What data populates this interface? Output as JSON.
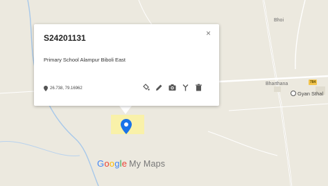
{
  "map": {
    "labels": {
      "bhoi": "Bhoi",
      "bharthana": "Bharthana",
      "poi": "Gyan Sthal"
    },
    "road_badge": "784"
  },
  "popup": {
    "title": "S24201131",
    "description": "Primary School Alampur Biboli East",
    "coordinates": "26.738, 79.16962",
    "close_symbol": "×"
  },
  "branding": {
    "google_letters": [
      "G",
      "o",
      "o",
      "g",
      "l",
      "e"
    ],
    "product": "My Maps"
  },
  "colors": {
    "marker": "#1a73e8",
    "parcel": "#fbf2a0",
    "river": "#a7c8ea"
  }
}
